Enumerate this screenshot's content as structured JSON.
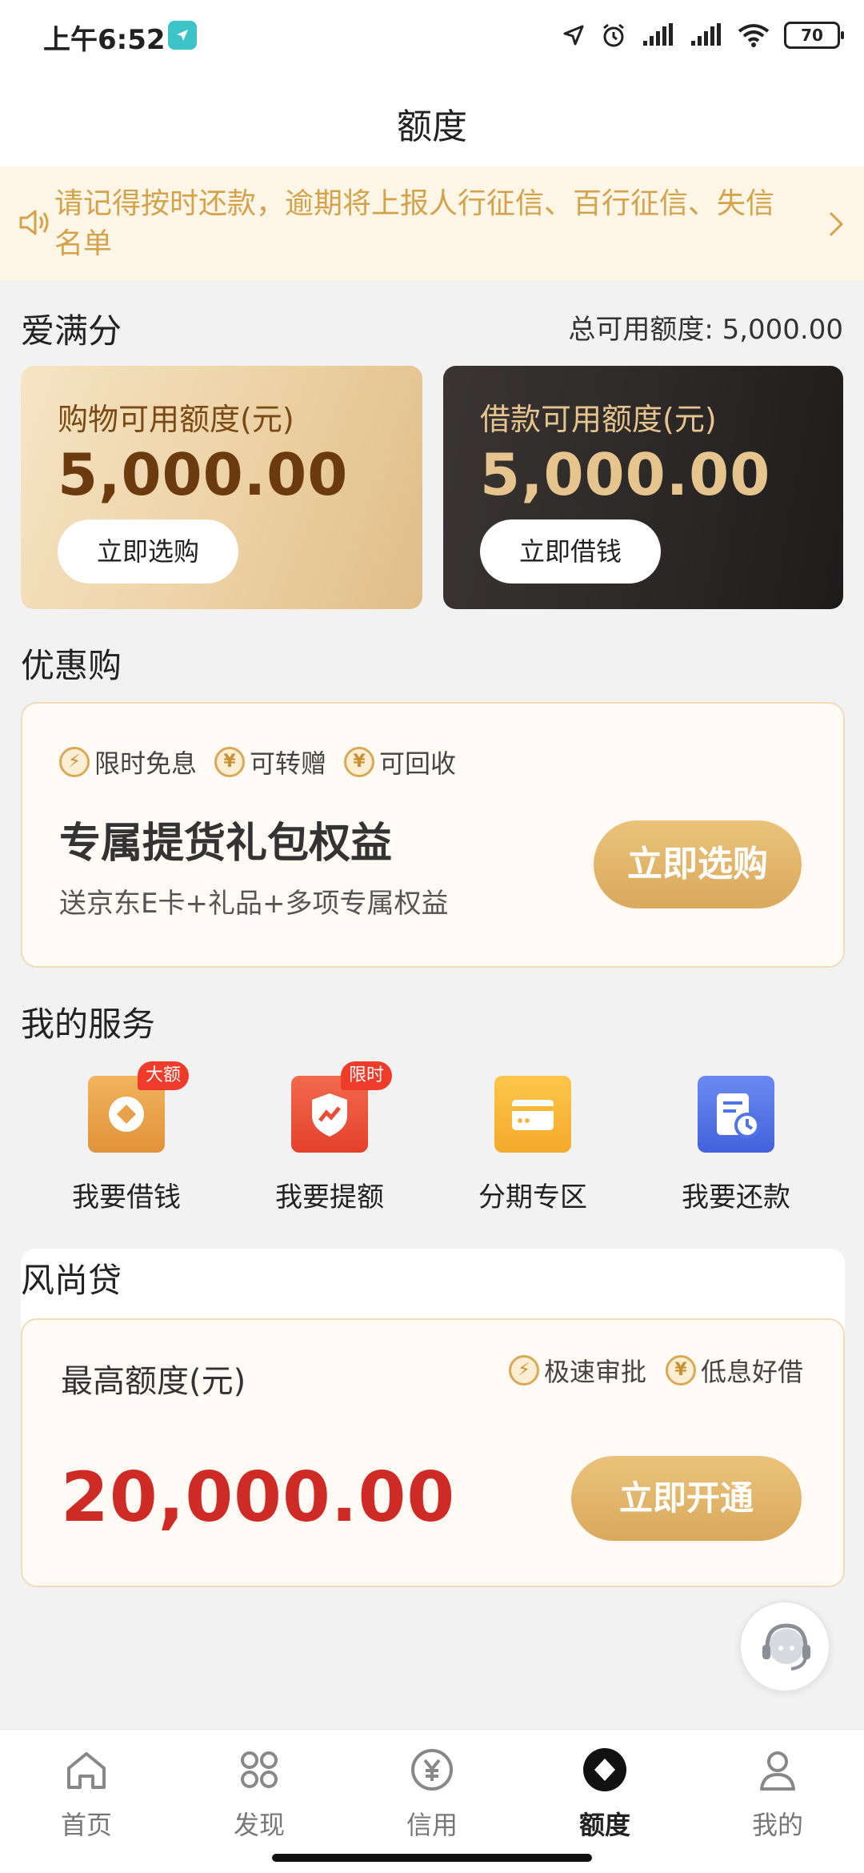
{
  "status_bar": {
    "time": "上午6:52",
    "battery": "70"
  },
  "header": {
    "title": "额度"
  },
  "notice": {
    "text": "请记得按时还款，逾期将上报人行征信、百行征信、失信名单"
  },
  "credit": {
    "section_title": "爱满分",
    "total_label": "总可用额度: 5,000.00",
    "shopping": {
      "label": "购物可用额度(元)",
      "amount": "5,000.00",
      "button": "立即选购"
    },
    "loan": {
      "label": "借款可用额度(元)",
      "amount": "5,000.00",
      "button": "立即借钱"
    }
  },
  "promo": {
    "section_title": "优惠购",
    "tags": [
      "限时免息",
      "可转赠",
      "可回收"
    ],
    "title": "专属提货礼包权益",
    "subtitle": "送京东E卡+礼品+多项专属权益",
    "button": "立即选购"
  },
  "services": {
    "section_title": "我的服务",
    "items": [
      {
        "label": "我要借钱",
        "badge": "大额",
        "icon": "loan-icon",
        "color": "#e9a04a"
      },
      {
        "label": "我要提额",
        "badge": "限时",
        "icon": "raise-limit-icon",
        "color": "#ec4b34"
      },
      {
        "label": "分期专区",
        "badge": "",
        "icon": "installment-icon",
        "color": "#f7b93a"
      },
      {
        "label": "我要还款",
        "badge": "",
        "icon": "repay-icon",
        "color": "#4f74e6"
      }
    ]
  },
  "fashion_loan": {
    "section_title": "风尚贷",
    "label": "最高额度(元)",
    "tags": [
      "极速审批",
      "低息好借"
    ],
    "amount": "20,000.00",
    "button": "立即开通"
  },
  "bottom_nav": {
    "items": [
      {
        "label": "首页",
        "icon": "home-icon"
      },
      {
        "label": "发现",
        "icon": "discover-icon"
      },
      {
        "label": "信用",
        "icon": "credit-icon"
      },
      {
        "label": "额度",
        "icon": "quota-icon",
        "active": true
      },
      {
        "label": "我的",
        "icon": "profile-icon"
      }
    ]
  },
  "colors": {
    "accent_gold": "#d9a95c",
    "amount_red": "#cf2b26",
    "notice_text": "#d4a24a"
  }
}
